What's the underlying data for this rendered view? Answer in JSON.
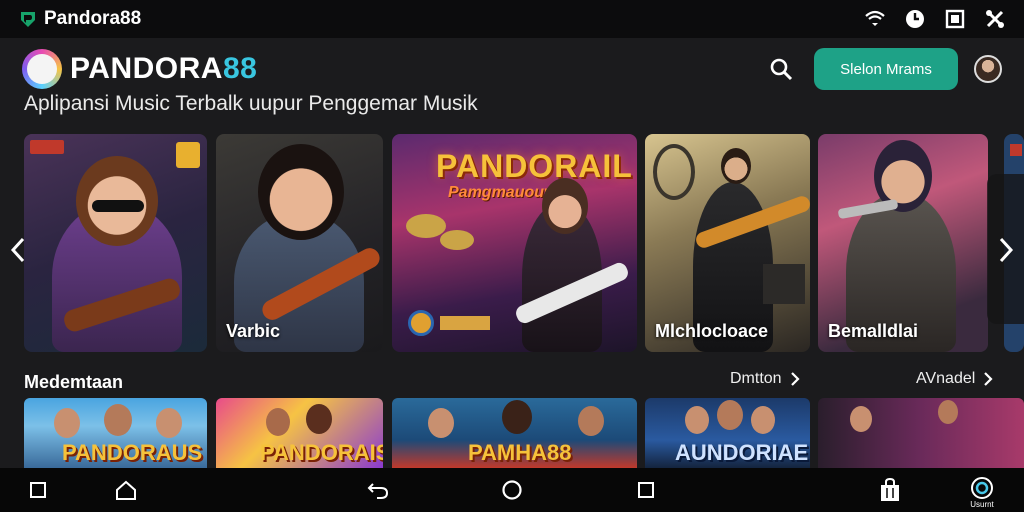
{
  "status_bar": {
    "brand": "Pandora88",
    "icons": [
      "wifi-icon",
      "clock-icon",
      "screen-icon",
      "tools-icon"
    ]
  },
  "header": {
    "logo_main": "PANDORA",
    "logo_accent": "88",
    "search_icon": "search-icon",
    "primary_button": "Slelon Mrams",
    "tagline": "Aplipansi Music Terbalk uupur Penggemar Musik"
  },
  "hero": {
    "cards": [
      {
        "caption": ""
      },
      {
        "caption": "Varbic"
      },
      {
        "caption": "",
        "art_title": "PANDORAIL",
        "art_sub": "Pamgmauouwo"
      },
      {
        "caption": "Mlchlocloace"
      },
      {
        "caption": "Bemalldlai"
      }
    ],
    "prev_icon": "chevron-left-icon",
    "next_icon": "chevron-right-icon"
  },
  "section": {
    "title": "Medemtaan",
    "link_1": "Dmtton",
    "link_2": "AVnadel"
  },
  "row": {
    "thumbs": [
      {
        "text": "PANDORAUS"
      },
      {
        "text": "PANDORAIS"
      },
      {
        "text": "PAMHA88"
      },
      {
        "text": "AUNDORIAE"
      },
      {
        "text": ""
      }
    ]
  },
  "nav_bar": {
    "icons": [
      "square-icon",
      "home-icon",
      "back-icon",
      "circle-home-icon",
      "recents-icon",
      "bag-icon",
      "account-icon"
    ],
    "last_label": "Usurnt"
  },
  "colors": {
    "accent": "#1ea287",
    "logo_accent": "#39c6e0",
    "art_title": "#f6c23a"
  }
}
